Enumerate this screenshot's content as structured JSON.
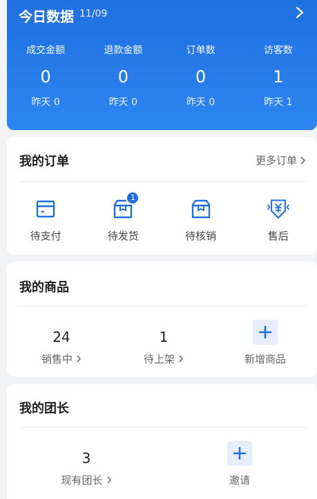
{
  "stats": {
    "title": "今日数据",
    "date": "11/09",
    "items": [
      {
        "label": "成交金额",
        "value": "0",
        "prev": "昨天 0"
      },
      {
        "label": "退款金额",
        "value": "0",
        "prev": "昨天 0"
      },
      {
        "label": "订单数",
        "value": "0",
        "prev": "昨天 0"
      },
      {
        "label": "访客数",
        "value": "1",
        "prev": "昨天 1"
      }
    ]
  },
  "orders": {
    "title": "我的订单",
    "more": "更多订单",
    "items": [
      {
        "label": "待支付",
        "icon": "wallet-icon"
      },
      {
        "label": "待发货",
        "icon": "box-icon",
        "badge": "1"
      },
      {
        "label": "待核销",
        "icon": "box-icon"
      },
      {
        "label": "售后",
        "icon": "yuan-shield-icon"
      }
    ]
  },
  "goods": {
    "title": "我的商品",
    "on_sale_count": "24",
    "on_sale_label": "销售中",
    "pending_count": "1",
    "pending_label": "待上架",
    "add_label": "新增商品"
  },
  "leaders": {
    "title": "我的团长",
    "count": "3",
    "count_label": "现有团长",
    "invite_label": "邀请"
  },
  "colors": {
    "accent": "#1f6fe0",
    "background": "#f2f3f5"
  }
}
